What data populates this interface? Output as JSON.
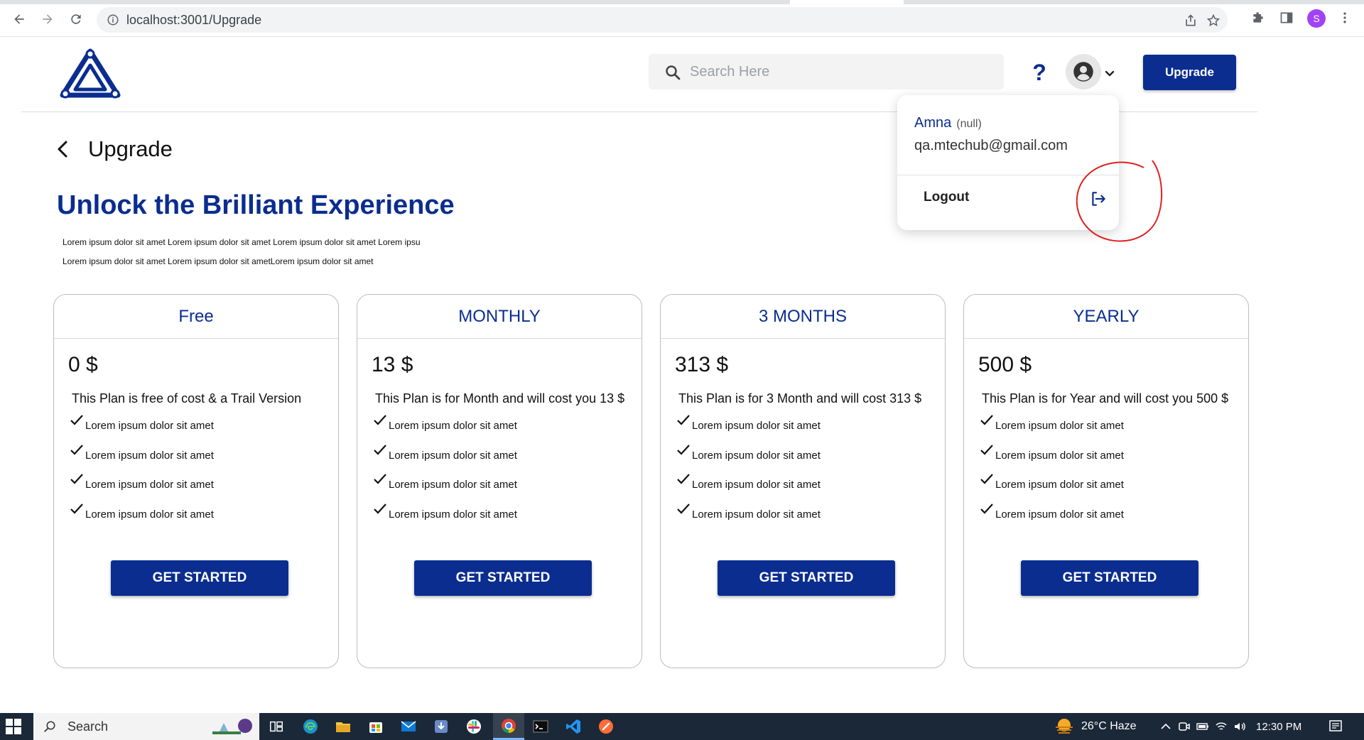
{
  "browser": {
    "url": "localhost:3001/Upgrade",
    "profile_initial": "S"
  },
  "header": {
    "search_placeholder": "Search Here",
    "help_label": "?",
    "upgrade_label": "Upgrade"
  },
  "page": {
    "title": "Upgrade",
    "hero_title": "Unlock the Brilliant Experience",
    "hero_desc_line1": "Lorem ipsum dolor sit amet Lorem ipsum dolor sit amet Lorem ipsum dolor sit amet Lorem ipsu",
    "hero_desc_line2": "Lorem ipsum dolor sit amet Lorem ipsum dolor sit ametLorem ipsum dolor sit amet"
  },
  "plans": [
    {
      "name": "Free",
      "price": "0 $",
      "description": "This Plan is free of cost & a Trail Version",
      "features": [
        "Lorem ipsum dolor sit amet",
        "Lorem ipsum dolor sit amet",
        "Lorem ipsum dolor sit amet",
        "Lorem ipsum dolor sit amet"
      ],
      "button": "GET STARTED"
    },
    {
      "name": "MONTHLY",
      "price": "13 $",
      "description": "This Plan is for Month and will cost you 13 $",
      "features": [
        "Lorem ipsum dolor sit amet",
        "Lorem ipsum dolor sit amet",
        "Lorem ipsum dolor sit amet",
        "Lorem ipsum dolor sit amet"
      ],
      "button": "GET STARTED"
    },
    {
      "name": "3 MONTHS",
      "price": "313 $",
      "description": "This Plan is for 3 Month and will cost 313 $",
      "features": [
        "Lorem ipsum dolor sit amet",
        "Lorem ipsum dolor sit amet",
        "Lorem ipsum dolor sit amet",
        "Lorem ipsum dolor sit amet"
      ],
      "button": "GET STARTED"
    },
    {
      "name": "YEARLY",
      "price": "500 $",
      "description": "This Plan is for Year and will cost you 500 $",
      "features": [
        "Lorem ipsum dolor sit amet",
        "Lorem ipsum dolor sit amet",
        "Lorem ipsum dolor sit amet",
        "Lorem ipsum dolor sit amet"
      ],
      "button": "GET STARTED"
    }
  ],
  "profile_menu": {
    "name": "Amna",
    "status": "(null)",
    "email": "qa.mtechub@gmail.com",
    "logout_label": "Logout"
  },
  "taskbar": {
    "search_label": "Search",
    "weather": "26°C  Haze",
    "time": "12:30 PM"
  },
  "colors": {
    "brand_primary": "#0a2d8f",
    "annotation_red": "#e02020",
    "taskbar_bg": "#1b2838"
  }
}
